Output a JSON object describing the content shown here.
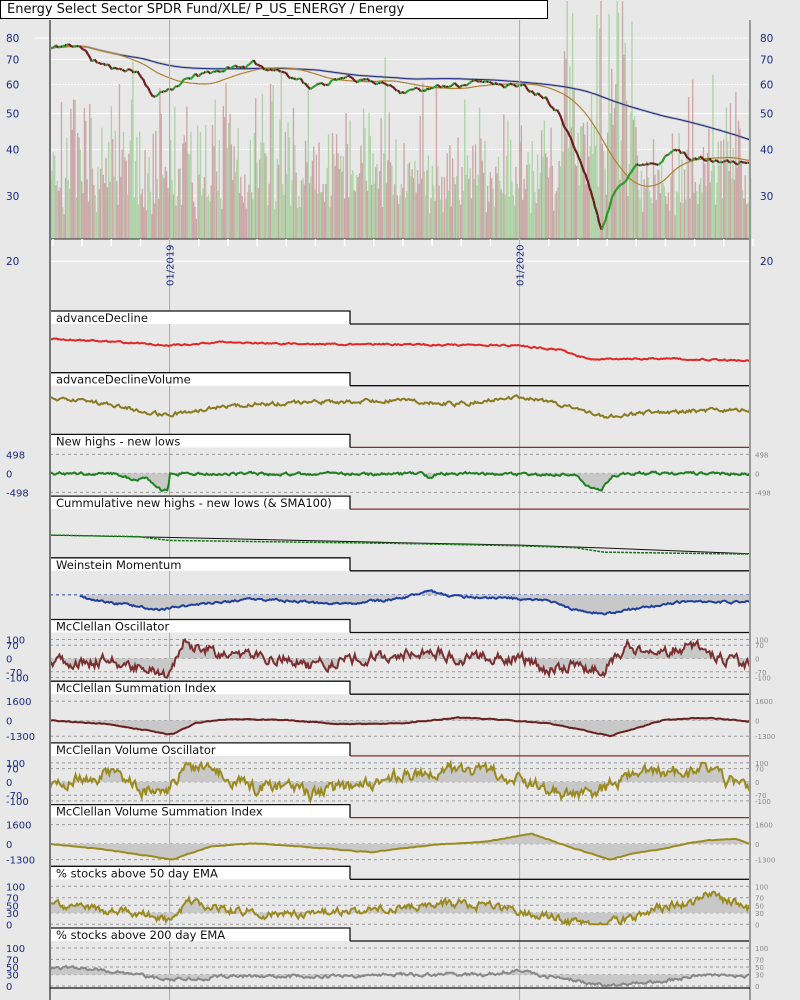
{
  "header": {
    "title": "Energy Select Sector SPDR Fund/XLE/ P_US_ENERGY / Energy"
  },
  "colors": {
    "up": "#2a9a2a",
    "down": "#6a1a1a",
    "sma200": "#1a2a8a",
    "sma50": "#b08030",
    "vol_up": "#a8d0a0",
    "vol_down": "#c8a0a0",
    "axis_text": "#1a2a80"
  },
  "chart_data": {
    "type": "line",
    "title": "Energy Select Sector SPDR Fund/XLE/ P_US_ENERGY / Energy",
    "x_unit": "months since 09/2018",
    "x_range": [
      0,
      24
    ],
    "x_dates": [
      {
        "label": "01/2019",
        "month": 4.1
      },
      {
        "label": "01/2020",
        "month": 16.1
      }
    ],
    "price": {
      "scale": "log",
      "ylim": [
        20,
        85
      ],
      "ticks": [
        "80",
        "70",
        "60",
        "50",
        "40",
        "30",
        "20"
      ],
      "tick_values": [
        80,
        70,
        60,
        50,
        40,
        30,
        20
      ],
      "close": [
        [
          0,
          75
        ],
        [
          1,
          77
        ],
        [
          1.4,
          70
        ],
        [
          2,
          67
        ],
        [
          3,
          65
        ],
        [
          3.6,
          55
        ],
        [
          4,
          58
        ],
        [
          5,
          63
        ],
        [
          6,
          66
        ],
        [
          7,
          68
        ],
        [
          8,
          65
        ],
        [
          8.5,
          62
        ],
        [
          9,
          59
        ],
        [
          10,
          62
        ],
        [
          11,
          62
        ],
        [
          12,
          58
        ],
        [
          13,
          58
        ],
        [
          14,
          60
        ],
        [
          15,
          61
        ],
        [
          16,
          60
        ],
        [
          17,
          56
        ],
        [
          17.5,
          50
        ],
        [
          18,
          40
        ],
        [
          18.6,
          30
        ],
        [
          18.9,
          24
        ],
        [
          19.3,
          30
        ],
        [
          20,
          36
        ],
        [
          21,
          38
        ],
        [
          21.5,
          40
        ],
        [
          22,
          38
        ],
        [
          23,
          37
        ],
        [
          24,
          37
        ]
      ],
      "overlays": [
        "SMA50",
        "SMA200"
      ]
    },
    "panels": [
      {
        "title": "advanceDecline",
        "color": "#e02828",
        "range": [
          0,
          10
        ],
        "ticks": [],
        "tick_labels": [],
        "fill": null,
        "noise": 0.35,
        "points": [
          [
            0,
            8
          ],
          [
            3,
            6.8
          ],
          [
            4,
            6.2
          ],
          [
            6,
            7
          ],
          [
            9,
            6.6
          ],
          [
            12,
            6.5
          ],
          [
            16,
            6.2
          ],
          [
            17.5,
            5
          ],
          [
            18.5,
            2.5
          ],
          [
            21,
            2.8
          ],
          [
            24,
            2.2
          ]
        ],
        "line_color": "black"
      },
      {
        "title": "advanceDeclineVolume",
        "color": "#8a7a20",
        "range": [
          0,
          10
        ],
        "ticks": [],
        "tick_labels": [],
        "fill": null,
        "noise": 0.8,
        "points": [
          [
            0,
            8.5
          ],
          [
            2,
            7
          ],
          [
            4,
            4
          ],
          [
            6,
            6.5
          ],
          [
            9,
            7.5
          ],
          [
            12,
            8
          ],
          [
            14,
            7
          ],
          [
            16,
            9
          ],
          [
            17.5,
            7
          ],
          [
            19,
            3.5
          ],
          [
            21,
            5
          ],
          [
            24,
            5.5
          ]
        ],
        "line_color": "black"
      },
      {
        "title": "New highs - new lows",
        "color": "#208020",
        "range": [
          -498,
          498
        ],
        "ticks": [
          498,
          0,
          -498
        ],
        "tick_labels": [
          "498",
          "0",
          "-498"
        ],
        "fill": 0,
        "noise": 60,
        "points": [
          [
            0,
            0
          ],
          [
            2.2,
            -20
          ],
          [
            2.8,
            -150
          ],
          [
            3.3,
            -120
          ],
          [
            3.8,
            -420
          ],
          [
            4.05,
            -450
          ],
          [
            4.1,
            0
          ],
          [
            12.8,
            -20
          ],
          [
            13,
            -120
          ],
          [
            13.3,
            0
          ],
          [
            18,
            -30
          ],
          [
            18.4,
            -350
          ],
          [
            18.9,
            -420
          ],
          [
            19.3,
            -60
          ],
          [
            20,
            0
          ],
          [
            24,
            0
          ]
        ],
        "line_color": "#803030"
      },
      {
        "title": "Cummulative new highs - new lows (& SMA100)",
        "color": "#1a7a1a",
        "range": [
          0,
          10
        ],
        "ticks": [],
        "tick_labels": [],
        "fill": null,
        "noise": 0,
        "points": [
          [
            0,
            5
          ],
          [
            3,
            4.6
          ],
          [
            4.1,
            3.6
          ],
          [
            12,
            2.8
          ],
          [
            16,
            2.2
          ],
          [
            18,
            1.7
          ],
          [
            19,
            0.5
          ],
          [
            24,
            0
          ]
        ],
        "sma": [
          [
            0,
            5
          ],
          [
            4,
            4.4
          ],
          [
            12,
            3.0
          ],
          [
            16,
            2.4
          ],
          [
            19,
            1.6
          ],
          [
            24,
            0.1
          ]
        ],
        "line_color": "#803030"
      },
      {
        "title": "Weinstein Momentum",
        "color": "#2040a0",
        "range": [
          0,
          10
        ],
        "ticks": [
          5.5
        ],
        "tick_labels": [],
        "fill": 5.5,
        "start": 1,
        "noise": 0.5,
        "ref_dashed": true,
        "points": [
          [
            1,
            5
          ],
          [
            2,
            3.5
          ],
          [
            3.8,
            1.6
          ],
          [
            5,
            3
          ],
          [
            7,
            4.4
          ],
          [
            9,
            3.5
          ],
          [
            10,
            3
          ],
          [
            12,
            4.5
          ],
          [
            13,
            6.5
          ],
          [
            14,
            5
          ],
          [
            16,
            4.5
          ],
          [
            17,
            4.2
          ],
          [
            18,
            1.5
          ],
          [
            19,
            0.6
          ],
          [
            21,
            3
          ],
          [
            22,
            3.8
          ],
          [
            24,
            3.5
          ]
        ],
        "line_color": "black"
      },
      {
        "title": "McClellan Oscillator",
        "color": "#7a3030",
        "range": [
          -100,
          100
        ],
        "ticks": [
          100,
          70,
          0,
          -70,
          -100
        ],
        "tick_labels": [
          "100",
          "70",
          "0",
          "-70",
          "-100"
        ],
        "fill": 0,
        "noise": 45,
        "points": [
          [
            0,
            -20
          ],
          [
            2,
            -10
          ],
          [
            3,
            -40
          ],
          [
            4,
            -80
          ],
          [
            4.3,
            0
          ],
          [
            4.6,
            85
          ],
          [
            6,
            20
          ],
          [
            8,
            0
          ],
          [
            9,
            -40
          ],
          [
            11,
            10
          ],
          [
            13,
            40
          ],
          [
            14,
            0
          ],
          [
            16,
            10
          ],
          [
            17,
            -60
          ],
          [
            18,
            -40
          ],
          [
            19,
            -50
          ],
          [
            19.8,
            60
          ],
          [
            21,
            40
          ],
          [
            22,
            60
          ],
          [
            23,
            0
          ],
          [
            24,
            -40
          ]
        ],
        "line_color": "black"
      },
      {
        "title": "McClellan Summation Index",
        "color": "#6a2020",
        "range": [
          -1300,
          1600
        ],
        "ticks": [
          1600,
          0,
          -1300
        ],
        "tick_labels": [
          "1600",
          "0",
          "-1300"
        ],
        "fill": 0,
        "noise": 60,
        "points": [
          [
            0,
            0
          ],
          [
            2,
            -300
          ],
          [
            3.5,
            -900
          ],
          [
            4.2,
            -1150
          ],
          [
            5,
            -200
          ],
          [
            6,
            100
          ],
          [
            8,
            50
          ],
          [
            10,
            -300
          ],
          [
            12,
            -250
          ],
          [
            14,
            250
          ],
          [
            15.5,
            50
          ],
          [
            17,
            -200
          ],
          [
            18.5,
            -900
          ],
          [
            19.2,
            -1300
          ],
          [
            20,
            -700
          ],
          [
            21,
            0
          ],
          [
            22,
            200
          ],
          [
            23,
            150
          ],
          [
            24,
            -100
          ]
        ],
        "line_color": "black"
      },
      {
        "title": "McClellan Volume Oscillator",
        "color": "#9a8a20",
        "range": [
          -100,
          100
        ],
        "ticks": [
          100,
          70,
          0,
          -70,
          -100
        ],
        "tick_labels": [
          "100",
          "70",
          "0",
          "-70",
          "-100"
        ],
        "fill": 0,
        "noise": 55,
        "points": [
          [
            0,
            -10
          ],
          [
            2,
            40
          ],
          [
            3,
            -30
          ],
          [
            4,
            -80
          ],
          [
            4.6,
            100
          ],
          [
            6,
            40
          ],
          [
            7,
            -40
          ],
          [
            8,
            -20
          ],
          [
            9,
            -60
          ],
          [
            11,
            0
          ],
          [
            13,
            50
          ],
          [
            14,
            60
          ],
          [
            16,
            30
          ],
          [
            17,
            -40
          ],
          [
            18,
            -80
          ],
          [
            19,
            -40
          ],
          [
            20,
            60
          ],
          [
            22,
            40
          ],
          [
            22.5,
            100
          ],
          [
            23,
            20
          ],
          [
            24,
            -40
          ]
        ],
        "line_color": "#803030"
      },
      {
        "title": "McClellan Volume Summation Index",
        "color": "#9a8a20",
        "range": [
          -1300,
          1600
        ],
        "ticks": [
          1600,
          0,
          -1300
        ],
        "tick_labels": [
          "1600",
          "0",
          "-1300"
        ],
        "fill": 0,
        "noise": 40,
        "points": [
          [
            0,
            0
          ],
          [
            2,
            -500
          ],
          [
            4.2,
            -1300
          ],
          [
            5.5,
            -200
          ],
          [
            7,
            50
          ],
          [
            9,
            -300
          ],
          [
            11,
            -700
          ],
          [
            13,
            -100
          ],
          [
            15,
            200
          ],
          [
            16.5,
            850
          ],
          [
            18,
            -400
          ],
          [
            19.2,
            -1300
          ],
          [
            20,
            -800
          ],
          [
            21,
            -400
          ],
          [
            22,
            100
          ],
          [
            22.5,
            300
          ],
          [
            23.5,
            400
          ],
          [
            24,
            0
          ]
        ],
        "line_color": "#803030"
      },
      {
        "title": "% stocks above 50 day EMA",
        "color": "#9a8a20",
        "range": [
          0,
          100
        ],
        "ticks": [
          100,
          70,
          50,
          30,
          0
        ],
        "tick_labels": [
          "100",
          "70",
          "50",
          "30",
          "0"
        ],
        "fill": 30,
        "noise": 16,
        "points": [
          [
            0,
            60
          ],
          [
            1,
            40
          ],
          [
            3,
            30
          ],
          [
            4,
            12
          ],
          [
            4.8,
            60
          ],
          [
            6,
            40
          ],
          [
            8,
            25
          ],
          [
            10,
            35
          ],
          [
            12,
            45
          ],
          [
            13,
            50
          ],
          [
            14,
            55
          ],
          [
            16,
            35
          ],
          [
            17,
            20
          ],
          [
            18,
            5
          ],
          [
            19,
            0
          ],
          [
            20,
            15
          ],
          [
            21,
            45
          ],
          [
            22,
            55
          ],
          [
            22.5,
            90
          ],
          [
            23,
            65
          ],
          [
            24,
            45
          ]
        ],
        "line_color": "black"
      },
      {
        "title": "% stocks above 200 day EMA",
        "color": "#888888",
        "range": [
          0,
          100
        ],
        "ticks": [
          100,
          70,
          50,
          30,
          0
        ],
        "tick_labels": [
          "100",
          "70",
          "50",
          "30",
          "0"
        ],
        "fill": 30,
        "noise": 7,
        "points": [
          [
            0,
            50
          ],
          [
            1.5,
            45
          ],
          [
            3,
            30
          ],
          [
            4,
            15
          ],
          [
            6,
            25
          ],
          [
            10,
            25
          ],
          [
            12,
            30
          ],
          [
            15,
            30
          ],
          [
            16,
            42
          ],
          [
            17,
            25
          ],
          [
            18.5,
            8
          ],
          [
            19.2,
            0
          ],
          [
            21,
            12
          ],
          [
            22,
            25
          ],
          [
            23,
            30
          ],
          [
            24,
            25
          ]
        ],
        "line_color": "black"
      }
    ]
  }
}
